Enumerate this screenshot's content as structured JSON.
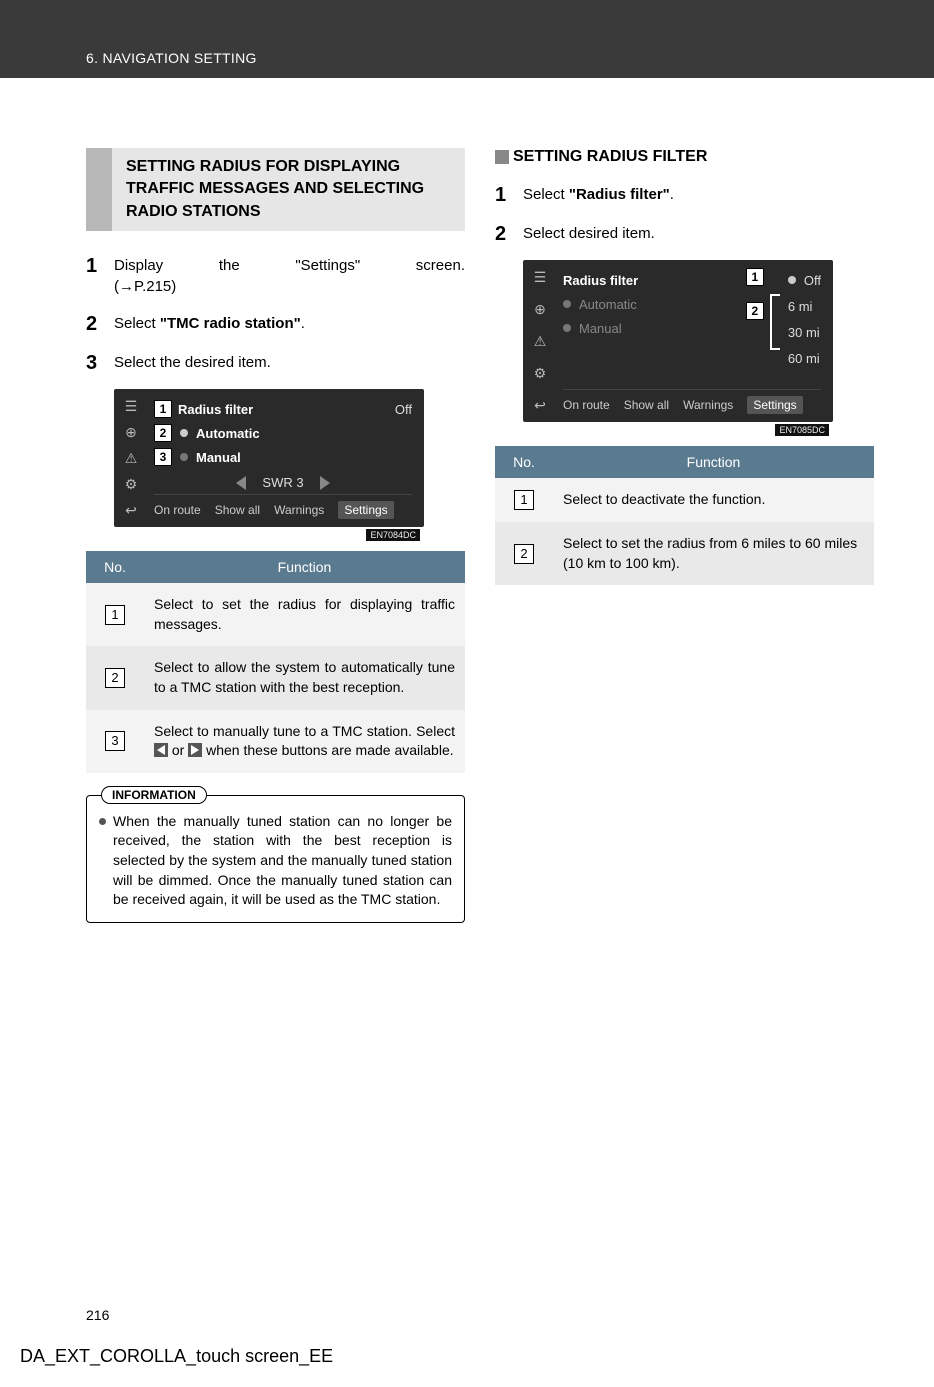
{
  "header": {
    "breadcrumb": "6. NAVIGATION SETTING"
  },
  "left": {
    "section_title": "SETTING RADIUS FOR DISPLAYING TRAFFIC MESSAGES AND SELECTING RADIO STATIONS",
    "steps": {
      "s1_pre": "Display the \"Settings\" screen.",
      "s1_ref": "(→P.215)",
      "s2_pre": "Select ",
      "s2_bold": "\"TMC radio station\"",
      "s2_post": ".",
      "s3": "Select the desired item."
    },
    "screenshot": {
      "radius_filter": "Radius filter",
      "off": "Off",
      "automatic": "Automatic",
      "manual": "Manual",
      "swr": "SWR 3",
      "tabs": {
        "on_route": "On route",
        "show_all": "Show all",
        "warnings": "Warnings",
        "settings": "Settings"
      },
      "ref": "EN7084DC",
      "callouts": {
        "c1": "1",
        "c2": "2",
        "c3": "3"
      }
    },
    "table": {
      "hdr_no": "No.",
      "hdr_func": "Function",
      "r1": "Select to set the radius for displaying traffic messages.",
      "r2": "Select to allow the system to automatically tune to a TMC station with the best reception.",
      "r3_a": "Select to manually tune to a TMC station. Select ",
      "r3_b": " or ",
      "r3_c": " when these buttons are made available."
    },
    "info": {
      "label": "INFORMATION",
      "text": "When the manually tuned station can no longer be received, the station with the best reception is selected by the system and the manually tuned station will be dimmed. Once the manually tuned station can be received again, it will be used as the TMC station."
    }
  },
  "right": {
    "sub_title": "SETTING RADIUS FILTER",
    "steps": {
      "s1_pre": "Select ",
      "s1_bold": "\"Radius filter\"",
      "s1_post": ".",
      "s2": "Select desired item."
    },
    "screenshot": {
      "radius_filter": "Radius filter",
      "automatic": "Automatic",
      "manual": "Manual",
      "opts": {
        "off": "Off",
        "d6": "6 mi",
        "d30": "30 mi",
        "d60": "60 mi"
      },
      "tabs": {
        "on_route": "On route",
        "show_all": "Show all",
        "warnings": "Warnings",
        "settings": "Settings"
      },
      "ref": "EN7085DC",
      "callouts": {
        "c1": "1",
        "c2": "2"
      }
    },
    "table": {
      "hdr_no": "No.",
      "hdr_func": "Function",
      "r1": "Select to deactivate the function.",
      "r2": "Select to set the radius from 6 miles to 60 miles (10 km to 100 km)."
    }
  },
  "page_number": "216",
  "footer_code": "DA_EXT_COROLLA_touch screen_EE"
}
